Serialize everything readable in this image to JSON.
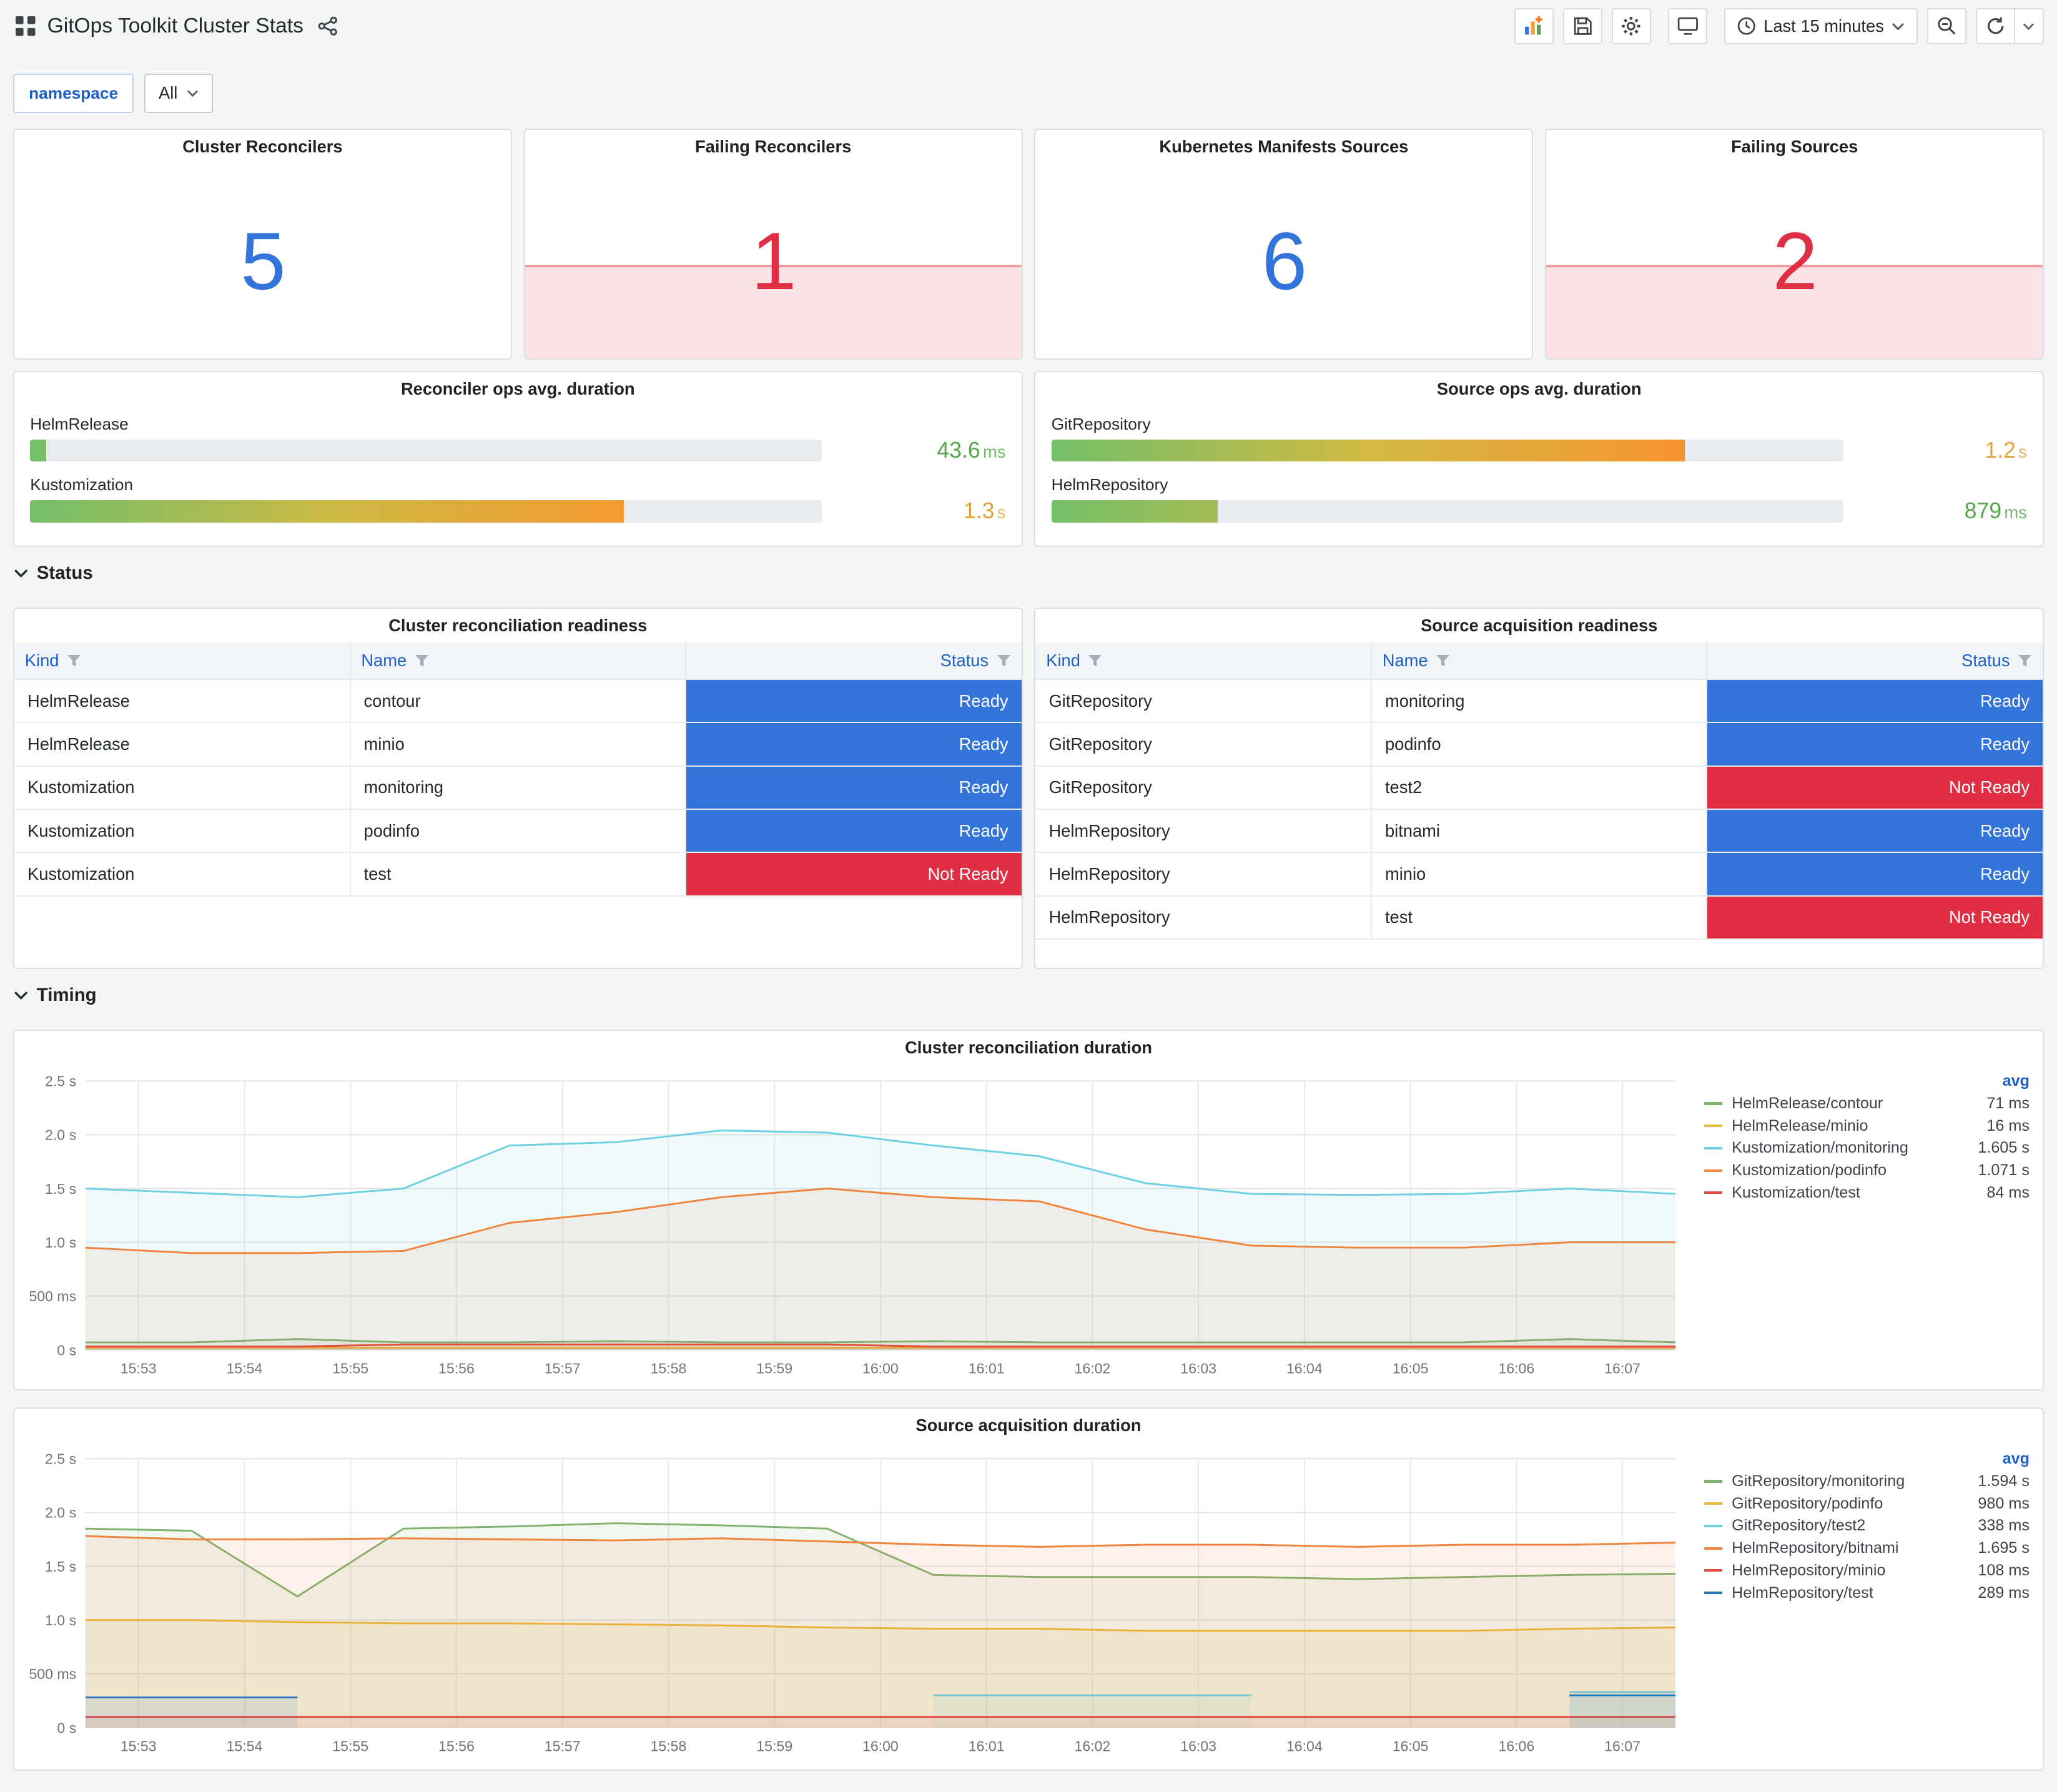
{
  "header": {
    "title": "GitOps Toolkit Cluster Stats"
  },
  "toolbar": {
    "time_range_label": "Last 15 minutes",
    "icons": [
      "add-panel",
      "save-dashboard",
      "dashboard-settings",
      "cycle-view-mode",
      "time-range",
      "zoom-out",
      "refresh",
      "refresh-interval"
    ]
  },
  "filters": {
    "label": "namespace",
    "value": "All"
  },
  "stats": [
    {
      "title": "Cluster Reconcilers",
      "value": "5",
      "color": "#3274D9",
      "sparkline": false
    },
    {
      "title": "Failing Reconcilers",
      "value": "1",
      "color": "#E02F44",
      "sparkline": true
    },
    {
      "title": "Kubernetes Manifests Sources",
      "value": "6",
      "color": "#3274D9",
      "sparkline": false
    },
    {
      "title": "Failing Sources",
      "value": "2",
      "color": "#E02F44",
      "sparkline": true
    }
  ],
  "gauges": [
    {
      "title": "Reconciler ops avg. duration",
      "rows": [
        {
          "label": "HelmRelease",
          "value": "43.6",
          "unit": "ms",
          "value_color": "#56A64B",
          "percent": 2
        },
        {
          "label": "Kustomization",
          "value": "1.3",
          "unit": "s",
          "value_color": "#E0A438",
          "percent": 75
        }
      ]
    },
    {
      "title": "Source ops avg. duration",
      "rows": [
        {
          "label": "GitRepository",
          "value": "1.2",
          "unit": "s",
          "value_color": "#E0A438",
          "percent": 80
        },
        {
          "label": "HelmRepository",
          "value": "879",
          "unit": "ms",
          "value_color": "#56A64B",
          "percent": 21
        }
      ]
    }
  ],
  "sections": {
    "status": "Status",
    "timing": "Timing"
  },
  "status_colors": {
    "Ready": "#3274D9",
    "Not Ready": "#E02F44"
  },
  "tables": [
    {
      "title": "Cluster reconciliation readiness",
      "columns": [
        "Kind",
        "Name",
        "Status"
      ],
      "rows": [
        [
          "HelmRelease",
          "contour",
          "Ready"
        ],
        [
          "HelmRelease",
          "minio",
          "Ready"
        ],
        [
          "Kustomization",
          "monitoring",
          "Ready"
        ],
        [
          "Kustomization",
          "podinfo",
          "Ready"
        ],
        [
          "Kustomization",
          "test",
          "Not Ready"
        ]
      ]
    },
    {
      "title": "Source acquisition readiness",
      "columns": [
        "Kind",
        "Name",
        "Status"
      ],
      "rows": [
        [
          "GitRepository",
          "monitoring",
          "Ready"
        ],
        [
          "GitRepository",
          "podinfo",
          "Ready"
        ],
        [
          "GitRepository",
          "test2",
          "Not Ready"
        ],
        [
          "HelmRepository",
          "bitnami",
          "Ready"
        ],
        [
          "HelmRepository",
          "minio",
          "Ready"
        ],
        [
          "HelmRepository",
          "test",
          "Not Ready"
        ]
      ]
    }
  ],
  "chart_data": [
    {
      "type": "line",
      "title": "Cluster reconciliation duration",
      "x_tick_labels": [
        "15:53",
        "15:54",
        "15:55",
        "15:56",
        "15:57",
        "15:58",
        "15:59",
        "16:00",
        "16:01",
        "16:02",
        "16:03",
        "16:04",
        "16:05",
        "16:06",
        "16:07"
      ],
      "y_ticks": [
        0,
        0.5,
        1.0,
        1.5,
        2.0,
        2.5
      ],
      "y_tick_labels": [
        "0 s",
        "500 ms",
        "1.0 s",
        "1.5 s",
        "2.0 s",
        "2.5 s"
      ],
      "ylim": [
        0,
        2.5
      ],
      "grid": true,
      "legend_position": "right",
      "legend_header": "avg",
      "series": [
        {
          "name": "HelmRelease/contour",
          "avg": "71 ms",
          "color": "#7EB26D",
          "values": [
            0.07,
            0.07,
            0.1,
            0.07,
            0.07,
            0.08,
            0.07,
            0.07,
            0.08,
            0.07,
            0.07,
            0.07,
            0.07,
            0.07,
            0.1,
            0.07
          ]
        },
        {
          "name": "HelmRelease/minio",
          "avg": "16 ms",
          "color": "#EAB839",
          "values": [
            0.02,
            0.02,
            0.02,
            0.02,
            0.02,
            0.02,
            0.02,
            0.02,
            0.02,
            0.02,
            0.02,
            0.02,
            0.02,
            0.02,
            0.02,
            0.02
          ]
        },
        {
          "name": "Kustomization/monitoring",
          "avg": "1.605 s",
          "color": "#6ED0E0",
          "values": [
            1.5,
            1.46,
            1.42,
            1.5,
            1.9,
            1.93,
            2.04,
            2.02,
            1.9,
            1.8,
            1.55,
            1.45,
            1.44,
            1.45,
            1.5,
            1.45
          ]
        },
        {
          "name": "Kustomization/podinfo",
          "avg": "1.071 s",
          "color": "#EF843C",
          "values": [
            0.95,
            0.9,
            0.9,
            0.92,
            1.18,
            1.28,
            1.42,
            1.5,
            1.42,
            1.38,
            1.12,
            0.97,
            0.95,
            0.95,
            1.0,
            1.0
          ]
        },
        {
          "name": "Kustomization/test",
          "avg": "84 ms",
          "color": "#E24D42",
          "values": [
            0.03,
            0.03,
            0.03,
            0.05,
            0.05,
            0.05,
            0.05,
            0.05,
            0.03,
            0.03,
            0.03,
            0.03,
            0.03,
            0.03,
            0.03,
            0.03
          ]
        }
      ]
    },
    {
      "type": "line",
      "title": "Source acquisition duration",
      "x_tick_labels": [
        "15:53",
        "15:54",
        "15:55",
        "15:56",
        "15:57",
        "15:58",
        "15:59",
        "16:00",
        "16:01",
        "16:02",
        "16:03",
        "16:04",
        "16:05",
        "16:06",
        "16:07"
      ],
      "y_ticks": [
        0,
        0.5,
        1.0,
        1.5,
        2.0,
        2.5
      ],
      "y_tick_labels": [
        "0 s",
        "500 ms",
        "1.0 s",
        "1.5 s",
        "2.0 s",
        "2.5 s"
      ],
      "ylim": [
        0,
        2.5
      ],
      "grid": true,
      "legend_position": "right",
      "legend_header": "avg",
      "series": [
        {
          "name": "GitRepository/monitoring",
          "avg": "1.594 s",
          "color": "#7EB26D",
          "values": [
            1.85,
            1.83,
            1.22,
            1.85,
            1.87,
            1.9,
            1.88,
            1.85,
            1.42,
            1.4,
            1.4,
            1.4,
            1.38,
            1.4,
            1.42,
            1.43
          ]
        },
        {
          "name": "GitRepository/podinfo",
          "avg": "980 ms",
          "color": "#EAB839",
          "values": [
            1.0,
            1.0,
            0.98,
            0.97,
            0.97,
            0.96,
            0.95,
            0.93,
            0.92,
            0.92,
            0.9,
            0.9,
            0.9,
            0.9,
            0.92,
            0.93
          ]
        },
        {
          "name": "GitRepository/test2",
          "avg": "338 ms",
          "color": "#6ED0E0",
          "values": [
            null,
            null,
            null,
            null,
            null,
            null,
            null,
            null,
            0.3,
            0.3,
            0.3,
            0.3,
            null,
            null,
            0.33,
            0.33
          ]
        },
        {
          "name": "HelmRepository/bitnami",
          "avg": "1.695 s",
          "color": "#EF843C",
          "values": [
            1.78,
            1.75,
            1.75,
            1.76,
            1.75,
            1.74,
            1.76,
            1.73,
            1.7,
            1.68,
            1.7,
            1.7,
            1.68,
            1.7,
            1.7,
            1.72
          ]
        },
        {
          "name": "HelmRepository/minio",
          "avg": "108 ms",
          "color": "#E24D42",
          "values": [
            0.1,
            0.1,
            0.1,
            0.1,
            0.1,
            0.1,
            0.1,
            0.1,
            0.1,
            0.1,
            0.1,
            0.1,
            0.1,
            0.1,
            0.1,
            0.1
          ]
        },
        {
          "name": "HelmRepository/test",
          "avg": "289 ms",
          "color": "#1F78C1",
          "values": [
            0.28,
            0.28,
            0.28,
            null,
            null,
            null,
            null,
            null,
            null,
            null,
            null,
            null,
            null,
            null,
            0.3,
            0.3
          ]
        }
      ]
    }
  ]
}
